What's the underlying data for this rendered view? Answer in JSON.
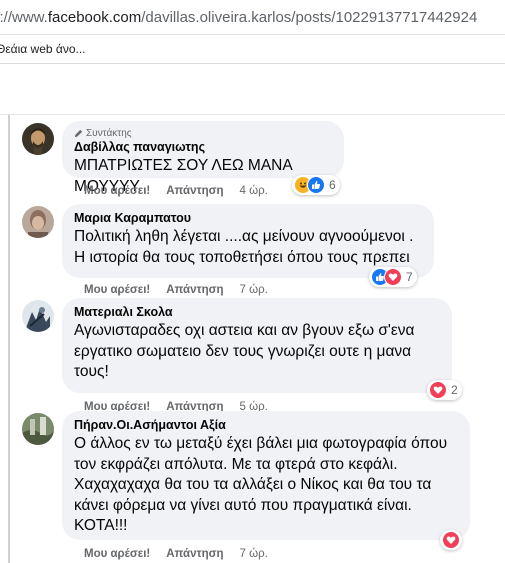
{
  "browser": {
    "url_prefix": "s://www.",
    "url_domain": "facebook.com",
    "url_path": "/davillas.oliveira.karlos/posts/10229137717442924",
    "bookmark": "Θεάια web άνο..."
  },
  "comments": [
    {
      "role": "Συντάκτης",
      "author": "Δαβίλλας παναγιωτης",
      "text": "ΜΠΑΤΡΙΩΤΕΣ ΣΟΥ ΛΕΩ ΜΑΝΑ ΜΟΥΥΥΥ",
      "like_label": "Μου αρέσει!",
      "reply_label": "Απάντηση",
      "time": "4 ώρ.",
      "reaction_count": "6",
      "reactions": [
        "haha-icon",
        "like-icon"
      ]
    },
    {
      "author": "Μαρια Καραμπατου",
      "text_lines": [
        "Πολιτική ληθη λέγεται ....ας μείνουν αγνοούμενοι .",
        "Η ιστορία θα τους τοποθετήσει όπου τους πρεπει"
      ],
      "like_label": "Μου αρέσει!",
      "reply_label": "Απάντηση",
      "time": "7 ώρ.",
      "reaction_count": "7",
      "reactions": [
        "like-icon",
        "love-icon"
      ]
    },
    {
      "author": "Ματεριαλι Σκολα",
      "text_lines": [
        "Αγωνισταραδες οχι αστεια και αν βγουν εξω σ'ενα",
        "εργατικο σωματειο δεν τους γνωριζει ουτε η μανα",
        "τους!"
      ],
      "like_label": "Μου αρέσει!",
      "reply_label": "Απάντηση",
      "time": "5 ώρ.",
      "reaction_count": "2",
      "reactions": [
        "love-icon"
      ]
    },
    {
      "author": "Πήραν.Οι.Ασήμαντοι Αξία",
      "text_lines": [
        "Ο άλλος εν τω μεταξύ έχει βάλει μια φωτογραφία όπου",
        "τον εκφράζει απόλυτα. Με τα φτερά στο κεφάλι.",
        "Χαχαχαχαχα θα του τα αλλάξει ο Νίκος και θα του τα",
        "κάνει φόρεμα να γίνει αυτό που πραγματικά είναι.",
        "ΚΟΤΑ!!!"
      ],
      "like_label": "Μου αρέσει!",
      "reply_label": "Απάντηση",
      "time": "7 ώρ.",
      "reactions": [
        "love-icon"
      ]
    }
  ],
  "colors": {
    "bubble": "#f0f2f5",
    "like": "#1877f2",
    "love": "#f33e58",
    "haha": "#f7b125"
  }
}
